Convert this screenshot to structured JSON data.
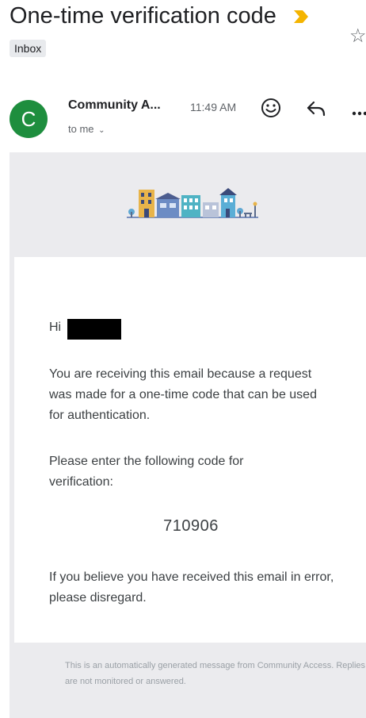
{
  "email": {
    "subject": "One-time verification code",
    "label": "Inbox",
    "sender": {
      "initial": "C",
      "name": "Community A...",
      "avatar_color": "#1e8e3e"
    },
    "time": "11:49 AM",
    "recipient": "to me",
    "icons": [
      "important-marker-icon",
      "star-icon",
      "emoji-icon",
      "reply-icon",
      "more-icon",
      "chevron-down-icon"
    ]
  },
  "body": {
    "greeting": "Hi",
    "paragraph1": "You are receiving this email because a request was made for a one-time code that can be used for authentication.",
    "paragraph2": "Please enter the following code for verification:",
    "code": "710906",
    "paragraph3": "If you believe you have received this email in error, please disregard.",
    "footer": "This is an automatically generated message from Community Access. Replies are not monitored or answered."
  },
  "colors": {
    "important_marker": "#f4b400",
    "mail_background": "#ebebee",
    "avatar": "#1e8e3e"
  }
}
